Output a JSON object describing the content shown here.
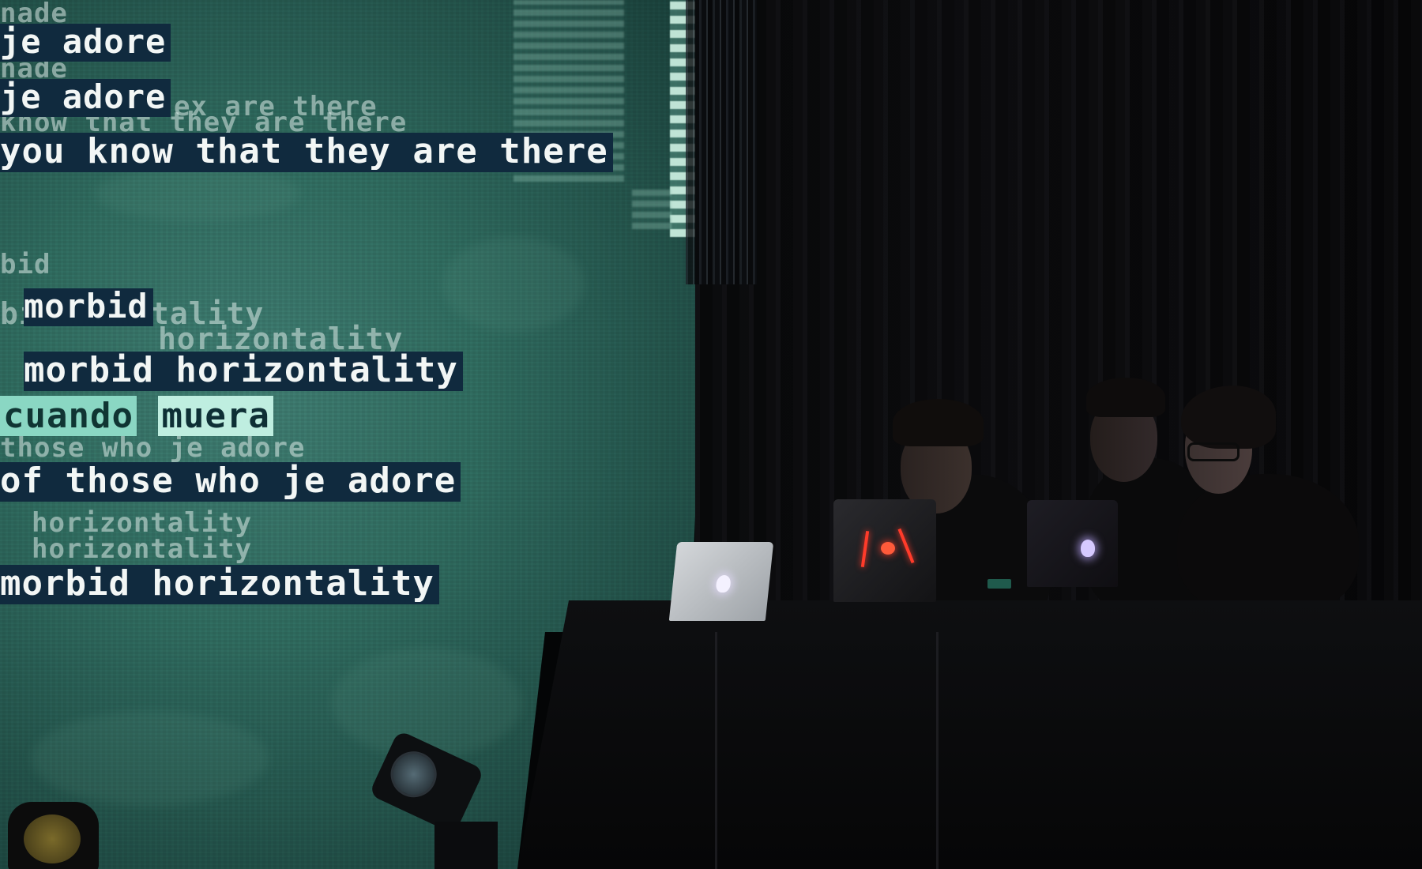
{
  "projection": {
    "lines": [
      "je adore",
      "je adore",
      "you know that they are there",
      "morbid",
      "morbid horizontality",
      "cuando",
      "muera",
      "of those who je adore",
      "morbid horizontality"
    ],
    "ghost_lines": [
      "nade",
      "nade",
      "ex are there",
      "know that they are there",
      "bid",
      "bid ozontality",
      "horizontality",
      "those who je adore",
      "horizontality",
      "horizontality"
    ]
  },
  "colors": {
    "screen": "#2f6a5e",
    "text": "#f2f6f5",
    "text_band": "#102a3e",
    "highlight": "#bfeee0",
    "curtain": "#08090a",
    "laptop_logo_red": "#ff3b2a",
    "laptop_logo_white": "#f4f1ff"
  },
  "objects": [
    "projection-screen",
    "black-curtain",
    "performance-table",
    "performer-left",
    "performer-middle",
    "performer-right",
    "laptop-silver",
    "laptop-red-logo",
    "laptop-dark",
    "stage-light-left",
    "stage-light-center"
  ]
}
